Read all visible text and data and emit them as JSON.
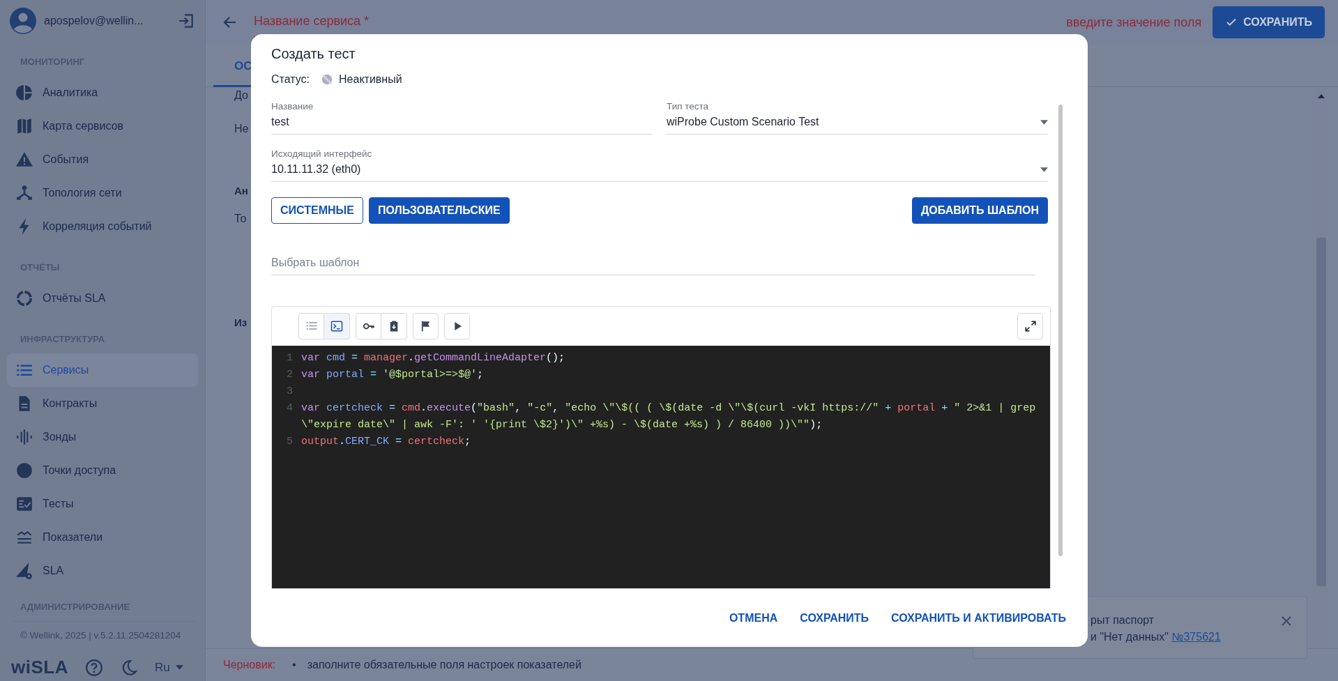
{
  "sidebar": {
    "user": "apospelov@wellin...",
    "sections": [
      {
        "title": "МОНИТОРИНГ",
        "items": [
          {
            "label": "Аналитика",
            "selected": false
          },
          {
            "label": "Карта сервисов",
            "selected": false
          },
          {
            "label": "События",
            "selected": false
          },
          {
            "label": "Топология сети",
            "selected": false
          },
          {
            "label": "Корреляция событий",
            "selected": false
          }
        ]
      },
      {
        "title": "ОТЧЁТЫ",
        "items": [
          {
            "label": "Отчёты SLA",
            "selected": false
          }
        ]
      },
      {
        "title": "ИНФРАСТРУКТУРА",
        "items": [
          {
            "label": "Сервисы",
            "selected": true
          },
          {
            "label": "Контракты",
            "selected": false
          },
          {
            "label": "Зонды",
            "selected": false
          },
          {
            "label": "Точки доступа",
            "selected": false
          },
          {
            "label": "Тесты",
            "selected": false
          },
          {
            "label": "Показатели",
            "selected": false
          },
          {
            "label": "SLA",
            "selected": false
          }
        ]
      },
      {
        "title": "АДМИНИСТРИРОВАНИЕ"
      }
    ],
    "copyright": "© Wellink, 2025 | v.5.2.11.2504281204",
    "logo": "wiSLA",
    "language": "Ru"
  },
  "header": {
    "field_label": "Название сервиса *",
    "error": "введите значение поля",
    "save_button": "СОХРАНИТЬ"
  },
  "tabs": [
    {
      "label": "ОС",
      "selected": true
    }
  ],
  "background_fragments": [
    {
      "text": "До",
      "kind": "text"
    },
    {
      "text": "Не",
      "kind": "text"
    },
    {
      "text": "Ан",
      "kind": "heading"
    },
    {
      "text": "То",
      "kind": "text"
    },
    {
      "text": "Из",
      "kind": "heading"
    }
  ],
  "modal": {
    "title": "Создать тест",
    "status_label": "Статус:",
    "status": "Неактивный",
    "active": false,
    "fields": [
      {
        "label": "Название",
        "value": "test",
        "kind": "text"
      },
      {
        "label": "Тип теста",
        "value": "wiProbe Custom Scenario Test",
        "kind": "select"
      },
      {
        "label": "Исходящий интерфейс",
        "value": "10.11.11.32 (eth0)",
        "kind": "select"
      }
    ],
    "template_tabs": [
      {
        "label": "СИСТЕМНЫЕ",
        "selected": false
      },
      {
        "label": "ПОЛЬЗОВАТЕЛЬСКИЕ",
        "selected": true
      }
    ],
    "add_template": "ДОБАВИТЬ ШАБЛОН",
    "template_select": {
      "placeholder": "Выбрать шаблон"
    },
    "editor": {
      "view_modes": [
        {
          "selected": false
        },
        {
          "selected": true
        }
      ],
      "code": [
        {
          "number": "1",
          "tokens": [
            {
              "text": "var",
              "kind": "keyword"
            },
            {
              "text": " cmd",
              "kind": "variable"
            },
            {
              "text": " =",
              "kind": "operator"
            },
            {
              "text": " manager",
              "kind": "object"
            },
            {
              "text": ".",
              "kind": "plain"
            },
            {
              "text": "getCommandLineAdapter",
              "kind": "method"
            },
            {
              "text": "();",
              "kind": "plain"
            }
          ]
        },
        {
          "number": "2",
          "tokens": [
            {
              "text": "var",
              "kind": "keyword"
            },
            {
              "text": " portal",
              "kind": "variable"
            },
            {
              "text": " =",
              "kind": "operator"
            },
            {
              "text": " '@$portal>=>$@'",
              "kind": "string"
            },
            {
              "text": ";",
              "kind": "plain"
            }
          ]
        },
        {
          "number": "3"
        },
        {
          "number": "4",
          "tokens": [
            {
              "text": "var",
              "kind": "keyword"
            },
            {
              "text": " certcheck",
              "kind": "variable"
            },
            {
              "text": " =",
              "kind": "operator"
            },
            {
              "text": " cmd",
              "kind": "object"
            },
            {
              "text": ".",
              "kind": "plain"
            },
            {
              "text": "execute",
              "kind": "method"
            },
            {
              "text": "(",
              "kind": "plain"
            },
            {
              "text": "\"bash\"",
              "kind": "string"
            },
            {
              "text": ", ",
              "kind": "plain"
            },
            {
              "text": "\"-c\"",
              "kind": "string"
            },
            {
              "text": ", ",
              "kind": "plain"
            },
            {
              "text": "\"echo \\\"\\$(( ( \\$(date -d \\\"\\$(curl -vkI https://\"",
              "kind": "string"
            },
            {
              "text": " +",
              "kind": "operator"
            },
            {
              "text": " portal",
              "kind": "object"
            },
            {
              "text": " +",
              "kind": "operator"
            },
            {
              "text": " \" 2>&1 | grep \\\"expire date\\\" | awk -F': ' '{print \\$2}')\\\" +%s) - \\$(date +%s) ) / 86400 ))\\\"\"",
              "kind": "string"
            },
            {
              "text": ");",
              "kind": "plain"
            }
          ]
        },
        {
          "number": "5",
          "tokens": [
            {
              "text": "output",
              "kind": "object"
            },
            {
              "text": ".",
              "kind": "plain"
            },
            {
              "text": "CERT_CK",
              "kind": "variable"
            },
            {
              "text": " =",
              "kind": "operator"
            },
            {
              "text": " certcheck",
              "kind": "object"
            },
            {
              "text": ";",
              "kind": "plain"
            }
          ]
        }
      ]
    },
    "actions": [
      "ОТМЕНА",
      "СОХРАНИТЬ",
      "СОХРАНИТЬ И АКТИВИРОВАТЬ"
    ]
  },
  "toast": {
    "line_1": "рыт паспорт",
    "line_2": "и \"Нет данных\" ",
    "link": "№375621"
  },
  "draft_bar": {
    "label": "Черновик:",
    "bullet": "•",
    "message": "заполните обязательные поля настроек показателей"
  }
}
